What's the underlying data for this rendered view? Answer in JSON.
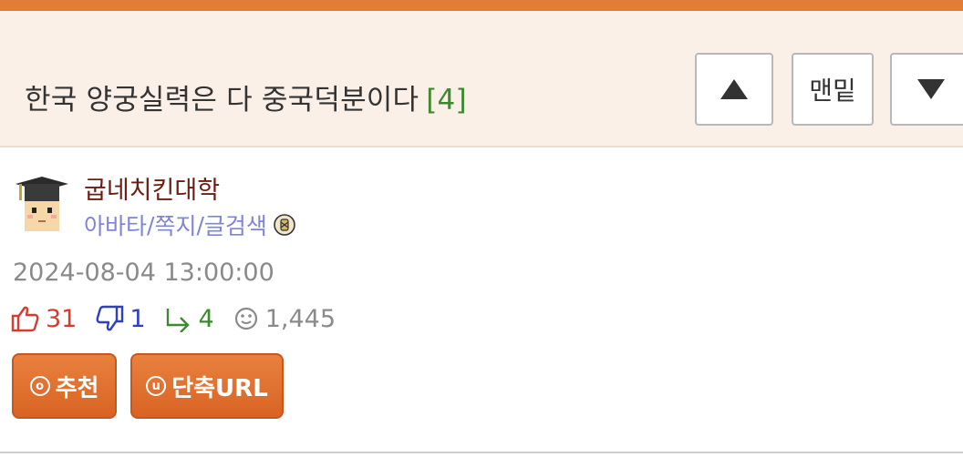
{
  "post": {
    "title": "한국 양궁실력은 다 중국덕분이다",
    "comment_count": "[4]"
  },
  "nav": {
    "bottom_label": "맨밑",
    "up_icon": "arrow-up-icon",
    "down_icon": "arrow-down-icon"
  },
  "author": {
    "name": "굽네치킨대학",
    "link_avatar": "아바타",
    "link_message": "쪽지",
    "link_search": "글검색",
    "separator": "/",
    "avatar_icon": "graduation-cap-avatar",
    "badge_icon": "member-badge-icon"
  },
  "meta": {
    "timestamp": "2024-08-04 13:00:00",
    "upvotes": "31",
    "downvotes": "1",
    "replies": "4",
    "views": "1,445"
  },
  "actions": {
    "recommend_label": "추천",
    "recommend_icon_char": "o",
    "shorturl_label": "단축URL",
    "shorturl_icon_char": "u"
  },
  "colors": {
    "accent": "#e27d35",
    "header_bg": "#faf0e8",
    "username": "#6d1c10",
    "links": "#7f84d8",
    "upvote": "#d83b2e",
    "downvote": "#2f3fbf",
    "reply": "#3c8a2e",
    "muted": "#8a8a8a"
  }
}
